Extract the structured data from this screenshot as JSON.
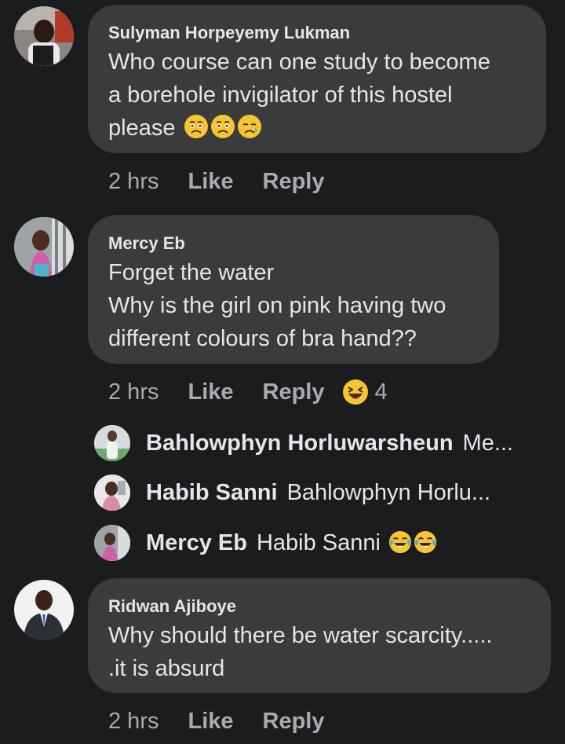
{
  "comments": [
    {
      "author": "Sulyman Horpeyemy Lukman",
      "text_lines": [
        "Who course can one study to become",
        "a borehole invigilator of this hostel",
        "please"
      ],
      "trailing_emojis": [
        "anxious-face-emoji",
        "anxious-face-emoji",
        "crying-face-emoji"
      ],
      "time": "2 hrs",
      "like_label": "Like",
      "reply_label": "Reply"
    },
    {
      "author": "Mercy Eb",
      "text_lines": [
        "Forget the water",
        "Why is the girl on pink having two",
        "different colours of bra hand??"
      ],
      "time": "2 hrs",
      "like_label": "Like",
      "reply_label": "Reply",
      "reaction": {
        "icon": "laughing-face-emoji",
        "count": "4"
      },
      "replies": [
        {
          "name": "Bahlowphyn Horluwarsheun",
          "text": "Me..."
        },
        {
          "name": "Habib Sanni",
          "text": "Bahlowphyn Horlu..."
        },
        {
          "name": "Mercy Eb",
          "text": "Habib Sanni",
          "emojis": [
            "tears-of-joy-emoji",
            "tears-of-joy-emoji"
          ]
        }
      ]
    },
    {
      "author": "Ridwan Ajiboye",
      "text_lines": [
        "Why should there be water scarcity.....",
        ".it is absurd"
      ],
      "time": "2 hrs",
      "like_label": "Like",
      "reply_label": "Reply"
    }
  ],
  "colors": {
    "background": "#1b1c1e",
    "bubble": "#3a3b3c",
    "text": "#e4e6eb",
    "muted": "#a8abb0",
    "emoji_yellow": "#f7c532"
  }
}
